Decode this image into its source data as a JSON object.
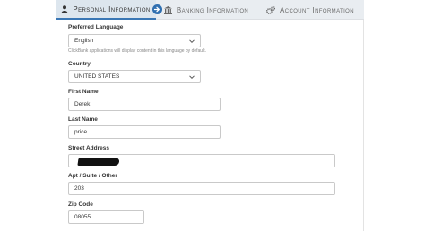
{
  "tabs": [
    {
      "label": "Personal Information",
      "icon": "person-icon",
      "active": true
    },
    {
      "label": "Banking Information",
      "icon": "bank-icon",
      "active": false
    },
    {
      "label": "Account Information",
      "icon": "gears-icon",
      "active": false
    }
  ],
  "form": {
    "language": {
      "label": "Preferred Language",
      "value": "English",
      "help": "ClickBank applications will display content in this language by default."
    },
    "country": {
      "label": "Country",
      "value": "UNITED STATES"
    },
    "first_name": {
      "label": "First Name",
      "value": "Derek"
    },
    "last_name": {
      "label": "Last Name",
      "value": "price"
    },
    "street": {
      "label": "Street Address",
      "value": ""
    },
    "apt": {
      "label": "Apt / Suite / Other",
      "value": "203"
    },
    "zip": {
      "label": "Zip Code",
      "value": "08055"
    }
  },
  "colors": {
    "accent": "#3a77b5",
    "tab_bg": "#e9edf1",
    "active_tab_bg": "#dde6ee"
  }
}
